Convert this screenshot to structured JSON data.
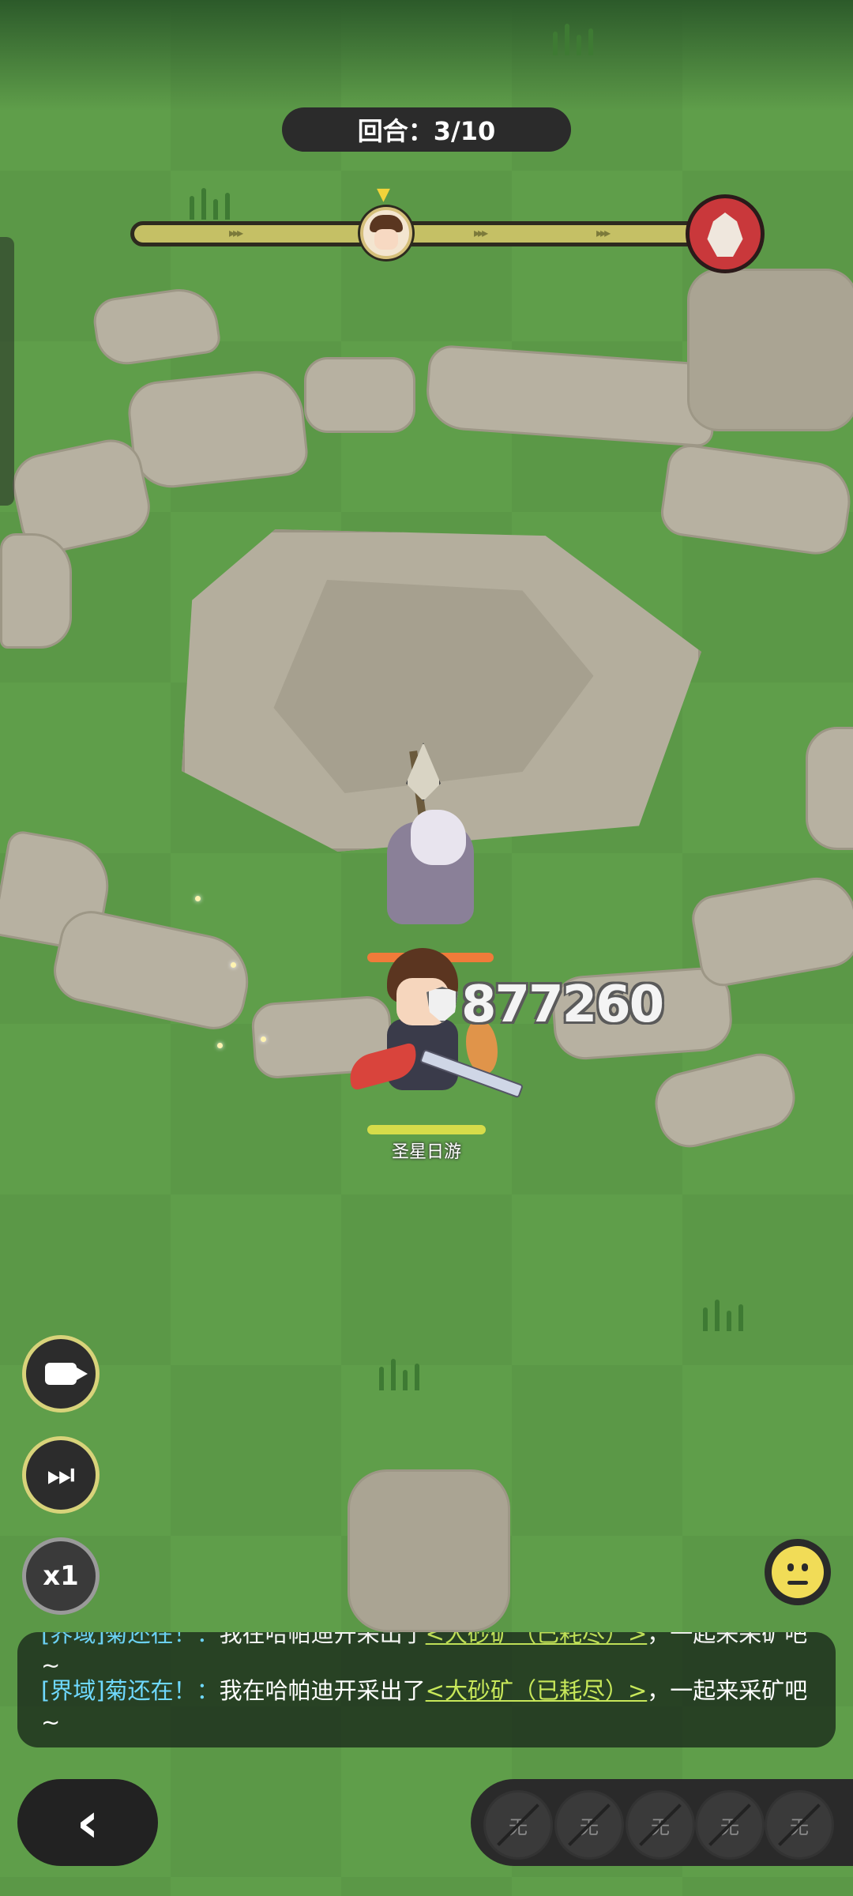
{
  "hud": {
    "turn_label": "回合：3/10"
  },
  "hero": {
    "name": "圣星日游"
  },
  "combat": {
    "damage_value": "877260"
  },
  "controls": {
    "camera_icon": "video-camera-icon",
    "skip_icon": "skip-forward-icon",
    "speed_label": "x1",
    "emoji_icon": "neutral-face-icon",
    "back_icon": "chevron-left-icon"
  },
  "chat": {
    "messages": [
      {
        "speaker": "[界域]菊还在！：",
        "text_before": "我在哈帕迪开采出了",
        "item": "<大砂矿（已耗尽）>",
        "text_after": "，一起来采矿吧~"
      },
      {
        "speaker": "[界域]菊还在！：",
        "text_before": "我在哈帕迪开采出了",
        "item": "<大砂矿（已耗尽）>",
        "text_after": "，一起来采矿吧~"
      }
    ]
  },
  "skill_slots": [
    {
      "label": "无"
    },
    {
      "label": "无"
    },
    {
      "label": "无"
    },
    {
      "label": "无"
    },
    {
      "label": "无"
    }
  ],
  "colors": {
    "grass": "#5f9e4a",
    "timeline": "#c5c065",
    "enemy_hp": "#f07b3a",
    "hero_hp": "#d6dc4a",
    "chat_speaker": "#6fd9ff",
    "chat_item": "#c8e85a"
  }
}
